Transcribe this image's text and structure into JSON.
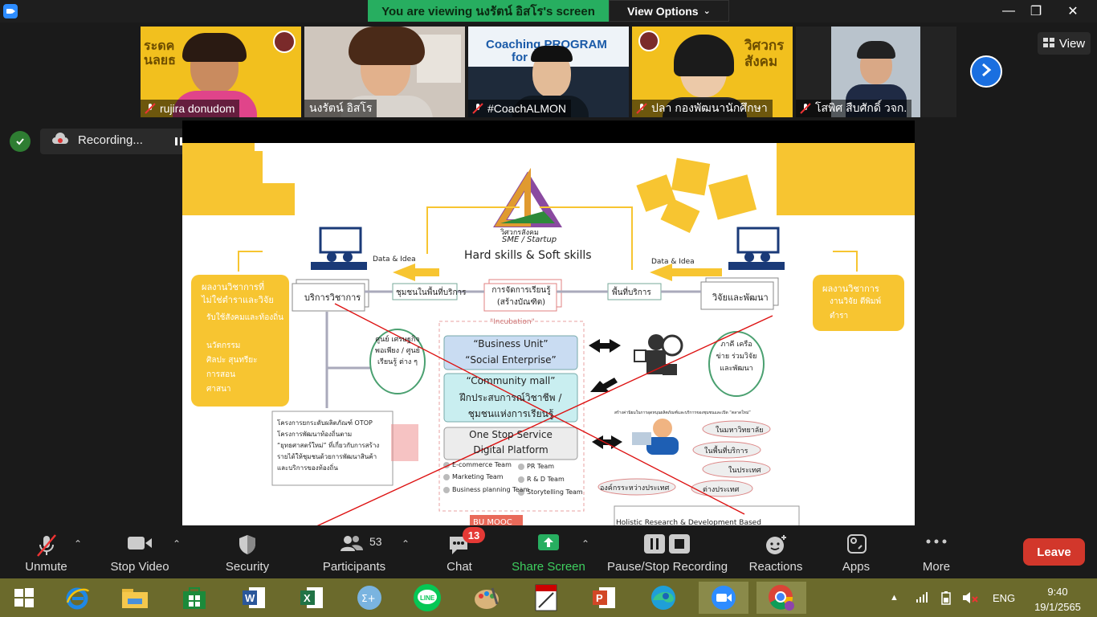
{
  "titlebar": {
    "banner": "You are viewing นงรัตน์ อิสโร's screen",
    "view_options": "View Options",
    "minimize": "—",
    "maximize": "❐",
    "close": "✕"
  },
  "participants_strip": [
    {
      "name": "rujira donudom"
    },
    {
      "name": "นงรัตน์ อิสโร"
    },
    {
      "name": "#CoachALMON"
    },
    {
      "name": "ปลา กองพัฒนานักศึกษา"
    },
    {
      "name": "โสพิศ สืบศักดิ์ วจก."
    }
  ],
  "thumb_text": {
    "coaching_line1": "Coaching PROGRAM",
    "coaching_line2": "for",
    "thumb1_big": "ระดค\nนลยธ",
    "thumb4_big": "วิศวกร\nสังคม"
  },
  "view_button": "View",
  "recording": {
    "label": "Recording..."
  },
  "slide": {
    "logo_caption1": "วิศวกรสังคม",
    "logo_caption2": "SME / Startup",
    "hard_soft": "Hard skills & Soft skills",
    "data_idea_left": "Data & Idea",
    "data_idea_right": "Data & Idea",
    "left_box_title": "ผลงานวิชาการที่ไม่ใช่ตำราและวิจัย",
    "left_box_items": [
      "รับใช้สังคมและท้องถิ่น",
      "นวัตกรรม",
      "ศิลปะ สุนทรียะ",
      "การสอน",
      "ศาสนา"
    ],
    "right_box_title": "ผลงานวิชาการ",
    "right_box_items": [
      "งานวิจัย ตีพิมพ์",
      "ตำรา"
    ],
    "service_label": "บริการวิชาการ",
    "community_area": "ชุมชนในพื้นที่บริการ",
    "learning": "การจัดการเรียนรู้ (สร้างบัณฑิต)",
    "service_area": "พื้นที่บริการ",
    "research": "วิจัยและพัฒนา",
    "incubation": "\"Incubation\"",
    "center_circle": "ศูนย์ เศรษฐกิจ พอเพียง / ศูนย์เรียนรู้ ต่าง ๆ",
    "business_unit": "“Business Unit”",
    "social_enterprise": "“Social Enterprise”",
    "community_mall": "“Community mall”",
    "career_practice": "ฝึกประสบการณ์วิชาชีพ /",
    "learning_community": "ชุมชนแห่งการเรียนรู้",
    "one_stop": "One Stop Service",
    "digital_platform": "Digital Platform",
    "teams_left": [
      "E-commerce Team",
      "Marketing Team",
      "Business planning Team"
    ],
    "teams_right": [
      "PR Team",
      "R & D Team",
      "Storytelling Team"
    ],
    "partner_circle": "ภาคี เครือข่าย ร่วมวิจัย และพัฒนา",
    "value_text": "สร้างค่านิยมในการอุดหนุนผลิตภัณฑ์และบริการของชุมชนและเปิด “ตลาดใหม่”",
    "ellipses": [
      "ในมหาวิทยาลัย",
      "ในพื้นที่บริการ",
      "ในประเทศ",
      "องค์กรระหว่างประเทศ",
      "ต่างประเทศ"
    ],
    "project_items": [
      "โครงการยกระดับผลิตภัณฑ์ OTOP",
      "โครงการพัฒนาท้องถิ่นตาม “ยุทธศาสตร์ใหม่” ที่เกี่ยวกับการสร้างรายได้ให้ชุมชนด้วยการพัฒนาสินค้าและบริการของท้องถิ่น"
    ],
    "holistic": "Holistic Research & Development Based",
    "bu_mooc": "BU MOOC"
  },
  "toolbar": {
    "unmute": "Unmute",
    "stop_video": "Stop Video",
    "security": "Security",
    "participants": "Participants",
    "participants_count": "53",
    "chat": "Chat",
    "chat_badge": "13",
    "share_screen": "Share Screen",
    "pause_stop": "Pause/Stop Recording",
    "reactions": "Reactions",
    "apps": "Apps",
    "more": "More",
    "leave": "Leave"
  },
  "taskbar": {
    "lang": "ENG",
    "time": "9:40",
    "date": "19/1/2565",
    "line_label": "LINE"
  },
  "colors": {
    "accent_green": "#27ae60",
    "slide_yellow": "#f7c531",
    "leave_red": "#d2372b",
    "taskbar": "#6b6a2c"
  }
}
